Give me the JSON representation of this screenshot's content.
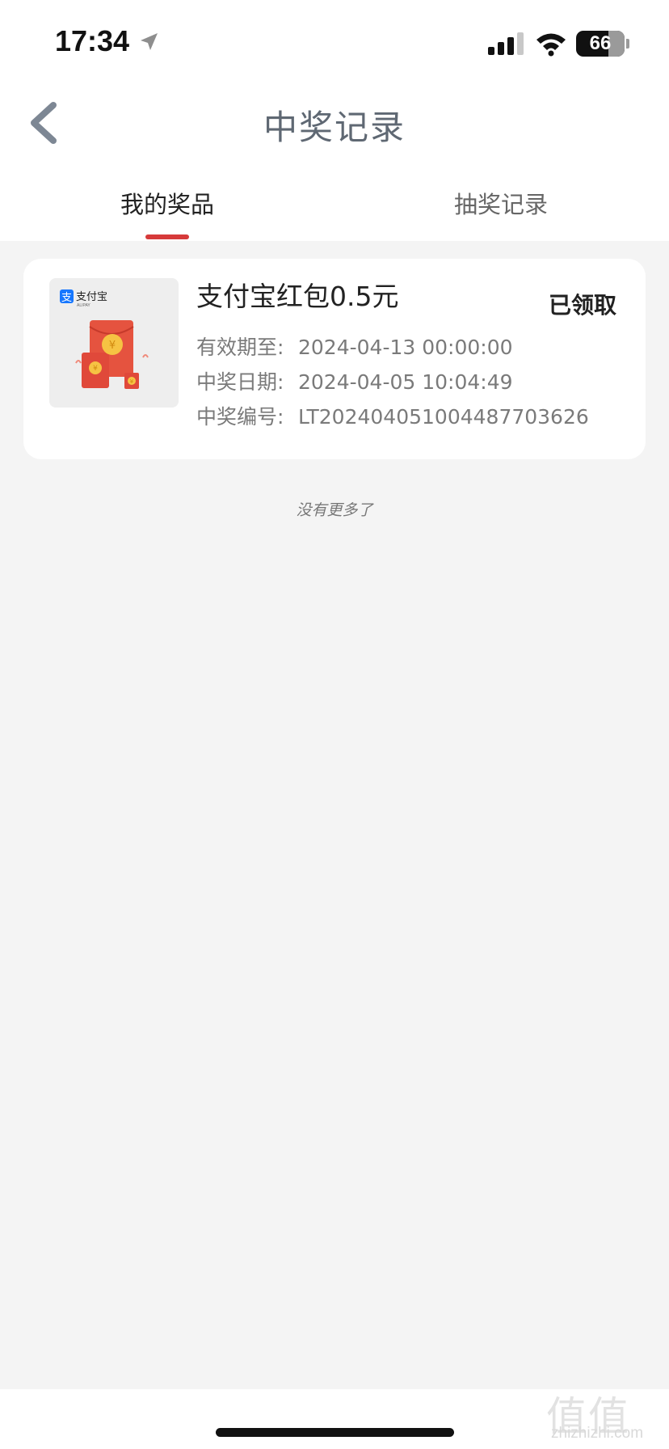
{
  "status_bar": {
    "time": "17:34",
    "battery": "66",
    "battery_level": 0.66,
    "icons": [
      "location-arrow-icon",
      "cellular-signal-icon",
      "wifi-icon",
      "battery-icon"
    ]
  },
  "nav": {
    "title": "中奖记录",
    "back_icon": "chevron-left-icon"
  },
  "tabs": [
    {
      "label": "我的奖品",
      "active": true
    },
    {
      "label": "抽奖记录",
      "active": false
    }
  ],
  "prizes": [
    {
      "brand": "支付宝",
      "brand_sub": "ALIPAY",
      "name": "支付宝红包0.5元",
      "status": "已领取",
      "valid_until_label": "有效期至:",
      "valid_until": "2024-04-13 00:00:00",
      "win_date_label": "中奖日期:",
      "win_date": "2024-04-05 10:04:49",
      "win_no_label": "中奖编号:",
      "win_no": "LT20240405100448770362 6"
    }
  ],
  "list_end_text": "没有更多了",
  "watermark": {
    "mark": "值值值",
    "text": "zhizhizhi.com"
  },
  "colors": {
    "accent": "#d63a3a",
    "background": "#f4f4f4",
    "card": "#ffffff",
    "title": "#5f6873",
    "envelope": "#e5533f",
    "coin": "#f6c343",
    "alipay_blue": "#1677ff"
  }
}
